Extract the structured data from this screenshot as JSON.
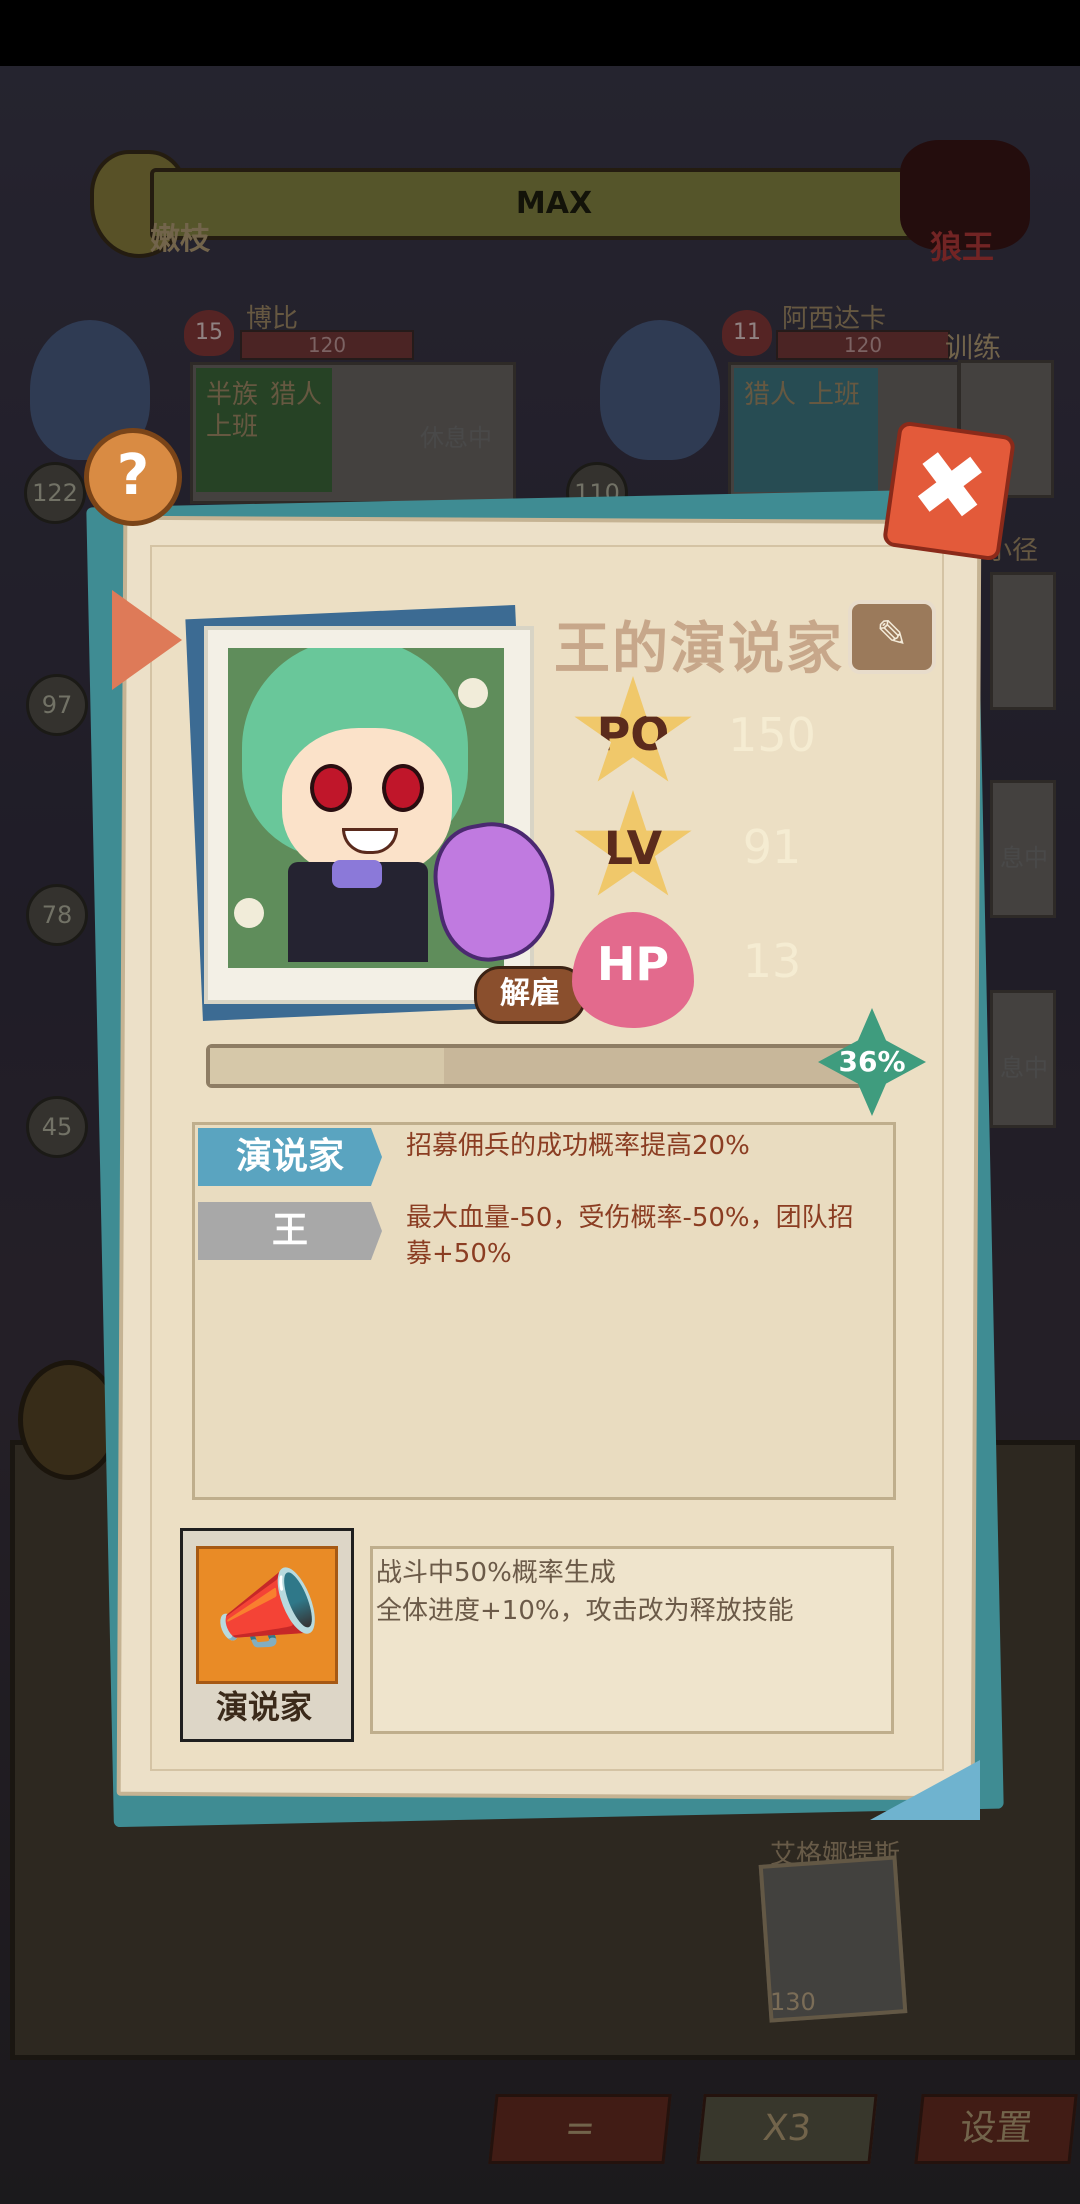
{
  "topbar": {
    "rank_left_label": "嫩枝",
    "level_text": "MAX",
    "rank_right_label": "狼王"
  },
  "background_cards": [
    {
      "name": "博比",
      "heart": "15",
      "hp": "120",
      "tags": [
        "半族",
        "猎人"
      ],
      "tag_extra": "上班",
      "status": "休息中",
      "level": "122"
    },
    {
      "name": "阿西达卡",
      "heart": "11",
      "hp": "120",
      "tags": [
        "猎人",
        "上班"
      ],
      "status": "",
      "level": "110"
    }
  ],
  "side_levels": [
    "97",
    "78",
    "45"
  ],
  "side_labels": {
    "train": "训练",
    "path": "小径",
    "rest1": "息中",
    "rest2": "息中"
  },
  "help_icon": "?",
  "close_icon": "✖",
  "character": {
    "name": "王的演说家",
    "fire_button": "解雇",
    "stats": [
      {
        "label": "PO",
        "value": "150",
        "color": "#f0d577"
      },
      {
        "label": "LV",
        "value": "91",
        "color": "#eea96a"
      },
      {
        "label": "HP",
        "value": "13",
        "color": "#ef9fb4"
      }
    ],
    "progress_label": "36%",
    "progress_value": 0.36
  },
  "traits": [
    {
      "tag": "演说家",
      "color": "#5aa4c0",
      "desc": "招募佣兵的成功概率提高20%"
    },
    {
      "tag": "王",
      "color": "#a8a8a8",
      "desc": "最大血量-50，受伤概率-50%，团队招募+50%"
    }
  ],
  "skill": {
    "name": "演说家",
    "desc_line1": "战斗中50%概率生成",
    "desc_line2": "全体进度+10%，攻击改为释放技能"
  },
  "bottom": {
    "character_name": "艾格娜提斯",
    "character_level": "130",
    "buttons": [
      "=",
      "X3",
      "设置"
    ]
  }
}
